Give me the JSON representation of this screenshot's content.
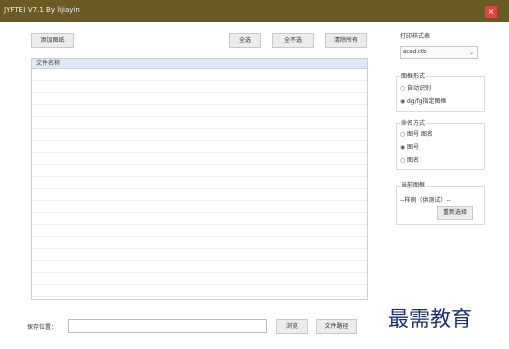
{
  "window": {
    "title": "JYFTE) V7.1 By lijiayin",
    "close_label": "×"
  },
  "toolbar": {
    "add_frames_label": "添加图纸",
    "select_all_label": "全选",
    "select_none_label": "全不选",
    "clear_all_label": "清除所有"
  },
  "file_list": {
    "column_header": "文件名称",
    "rows": []
  },
  "print_style": {
    "title": "打印样式表",
    "selected": "acad.ctb"
  },
  "frame_form": {
    "title": "图框形式",
    "options": [
      "自动识别",
      "dg/fg指定图框"
    ],
    "selected_index": 1
  },
  "naming": {
    "title": "命名方式",
    "options": [
      "图号 图名",
      "图号",
      "图名"
    ],
    "selected_index": 1
  },
  "current_frame": {
    "title": "当前图框",
    "value": "--样例（供测试）--",
    "reselect_label": "重新选择"
  },
  "save": {
    "label": "保存位置：",
    "path_value": "",
    "browse_label": "浏览",
    "file_path_label": "文件路径"
  },
  "watermark": "最需教育"
}
